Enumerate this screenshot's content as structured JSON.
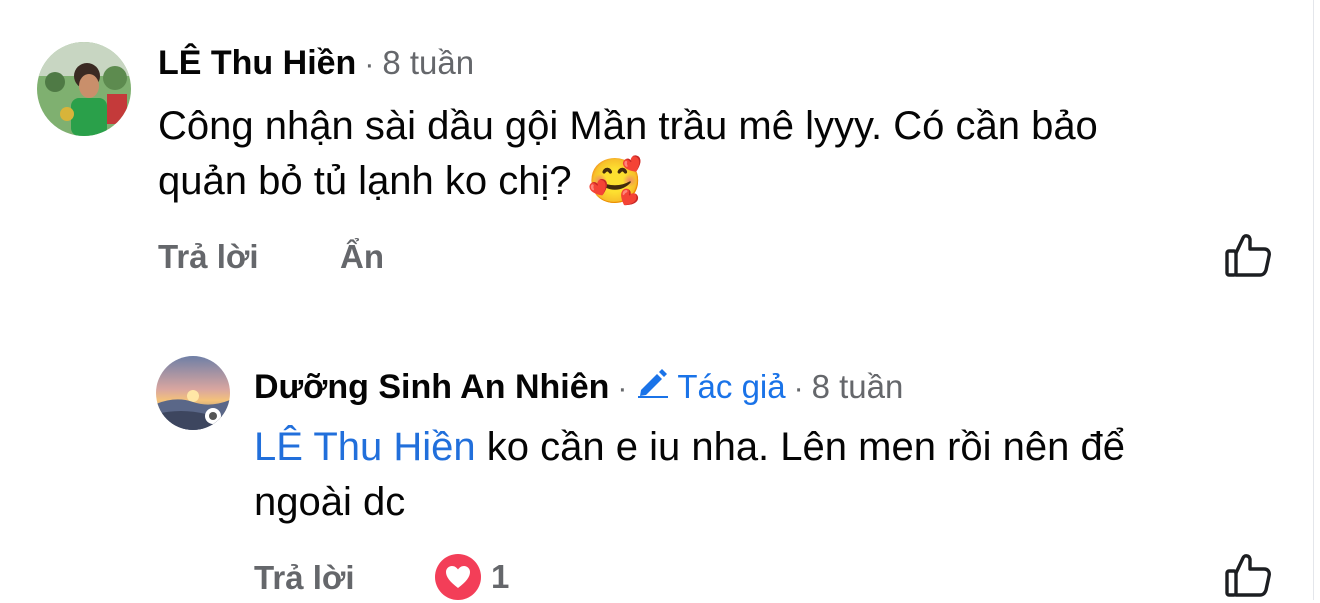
{
  "comments": [
    {
      "author": "LÊ Thu Hiền",
      "time": "8 tuần",
      "body_line1": "Công nhận sài dầu gội Mần trầu mê lyyy. Có cần bảo",
      "body_line2": "quản bỏ tủ lạnh ko chị?",
      "emoji": "🥰",
      "actions": {
        "reply": "Trả lời",
        "hide": "Ẩn"
      },
      "avatar_icon": "user-photo-avatar"
    }
  ],
  "reply": {
    "author": "Dưỡng Sinh An Nhiên",
    "author_badge": "Tác giả",
    "time": "8 tuần",
    "mention": "LÊ Thu Hiền",
    "body_line1": "ko cần e iu nha. Lên men rồi nên để",
    "body_line2": "ngoài dc",
    "actions": {
      "reply": "Trả lời"
    },
    "reaction_count": "1",
    "reaction_icon": "heart-icon",
    "avatar_icon": "sunset-photo-avatar"
  },
  "colors": {
    "mention": "#216fdb",
    "author_badge": "#1a73e8",
    "secondary_text": "#65676b",
    "heart": "#f33e58"
  }
}
